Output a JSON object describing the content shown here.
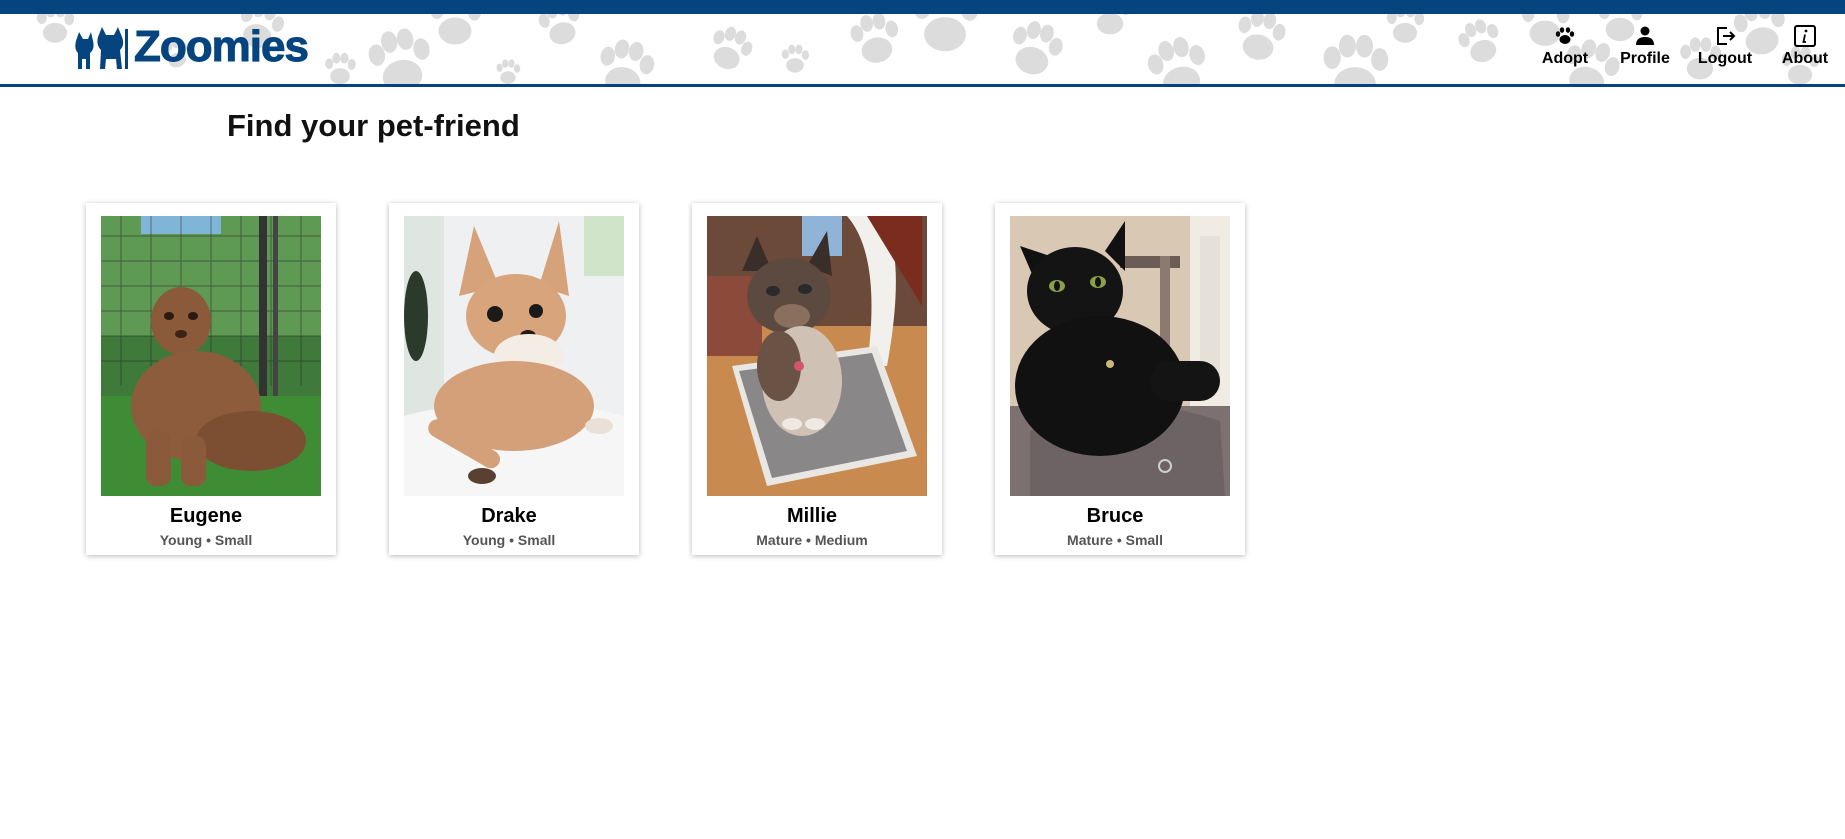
{
  "brand": {
    "name": "Zoomies",
    "color": "#05447f"
  },
  "nav": {
    "items": [
      {
        "label": "Adopt",
        "icon": "paw-icon"
      },
      {
        "label": "Profile",
        "icon": "person-icon"
      },
      {
        "label": "Logout",
        "icon": "logout-icon"
      },
      {
        "label": "About",
        "icon": "info-icon"
      }
    ]
  },
  "main": {
    "title": "Find your pet-friend"
  },
  "pets": [
    {
      "name": "Eugene",
      "meta": "Young • Small",
      "photo": "brown-scruffy-dog-on-grass"
    },
    {
      "name": "Drake",
      "meta": "Young • Small",
      "photo": "tan-chihuahua-on-bed"
    },
    {
      "name": "Millie",
      "meta": "Mature • Medium",
      "photo": "tortoiseshell-cat-on-chair"
    },
    {
      "name": "Bruce",
      "meta": "Mature • Small",
      "photo": "black-cat-on-cat-tree"
    }
  ]
}
